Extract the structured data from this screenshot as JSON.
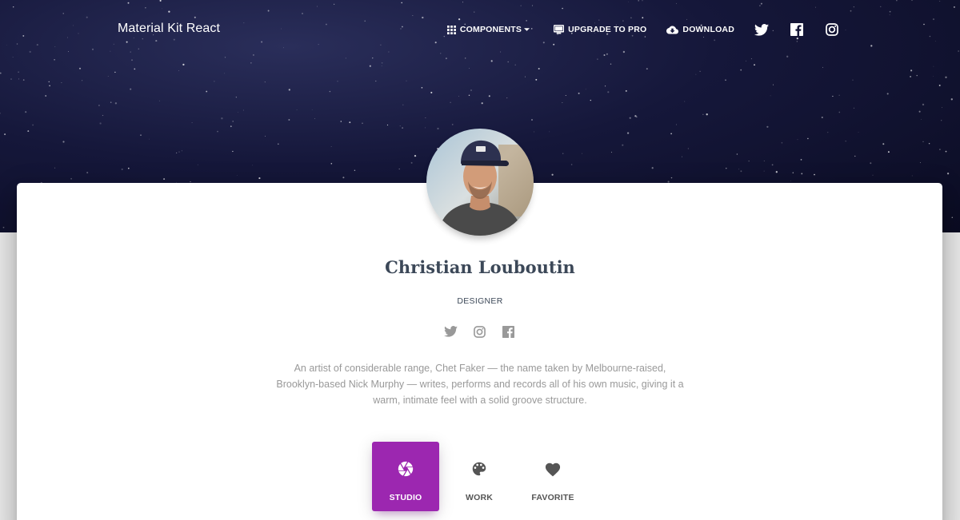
{
  "navbar": {
    "brand": "Material Kit React",
    "links": [
      {
        "label": "COMPONENTS",
        "icon": "apps-grid-icon",
        "has_caret": true
      },
      {
        "label": "UPGRADE TO PRO",
        "icon": "monitor-icon"
      },
      {
        "label": "DOWNLOAD",
        "icon": "cloud-download-icon"
      }
    ],
    "social_icons": [
      "twitter-icon",
      "facebook-icon",
      "instagram-icon"
    ]
  },
  "profile": {
    "name": "Christian Louboutin",
    "role": "DESIGNER",
    "social_icons": [
      "twitter-icon",
      "instagram-icon",
      "facebook-icon"
    ],
    "bio": "An artist of considerable range, Chet Faker — the name taken by Melbourne-raised, Brooklyn-based Nick Murphy — writes, performs and records all of his own music, giving it a warm, intimate feel with a solid groove structure."
  },
  "tabs": [
    {
      "label": "STUDIO",
      "icon": "camera-aperture-icon",
      "active": true
    },
    {
      "label": "WORK",
      "icon": "palette-icon",
      "active": false
    },
    {
      "label": "FAVORITE",
      "icon": "heart-icon",
      "active": false
    }
  ],
  "colors": {
    "accent": "#9c27b0",
    "hero_bg": "#15173a",
    "text_dark": "#3c4858",
    "text_muted": "#999999",
    "page_bg": "#e5e5e5"
  }
}
